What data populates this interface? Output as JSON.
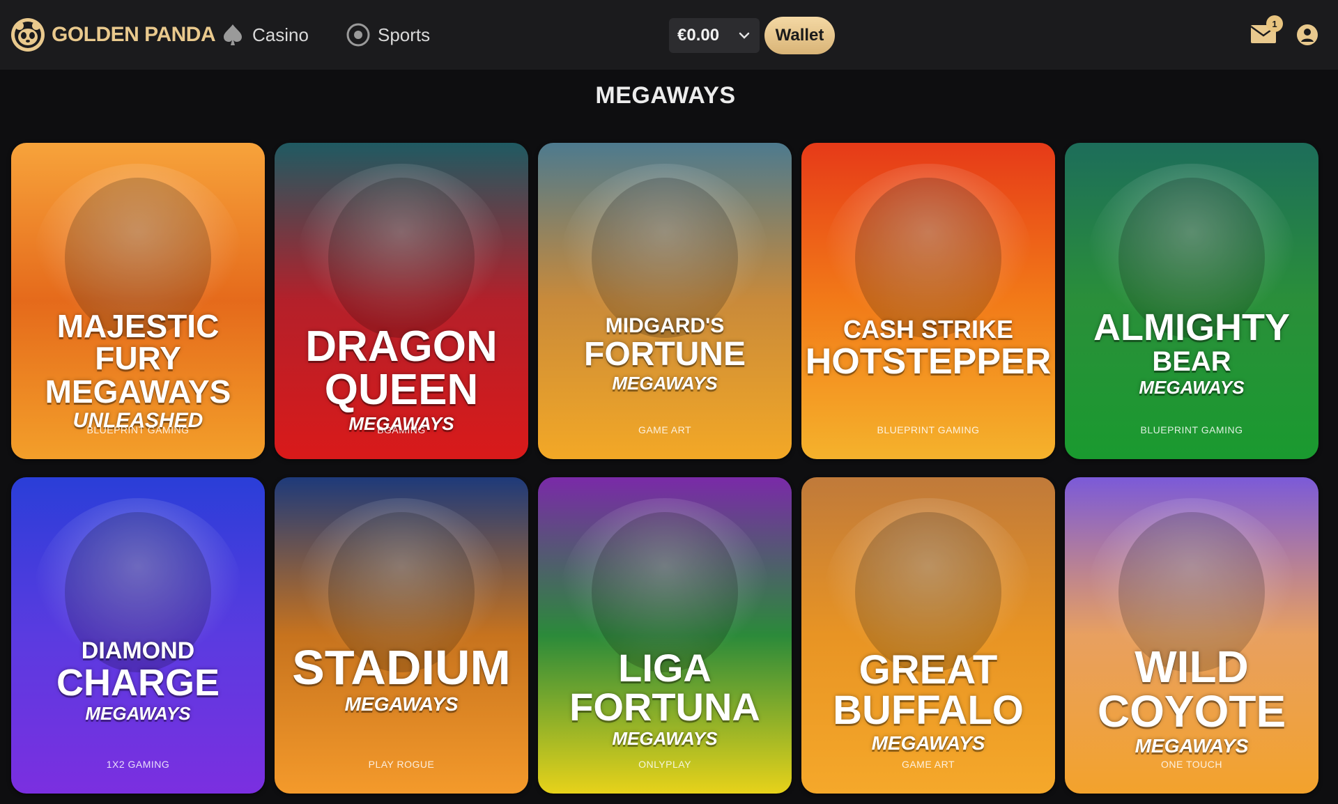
{
  "header": {
    "logo_text": "GOLDEN PANDA",
    "nav": [
      {
        "label": "Casino",
        "icon": "spade-icon"
      },
      {
        "label": "Sports",
        "icon": "soccer-ball-icon"
      }
    ],
    "balance": "€0.00",
    "wallet_label": "Wallet",
    "mail_badge": "1"
  },
  "section": {
    "title": "MEGAWAYS"
  },
  "games": [
    {
      "line1": "MAJESTIC FURY",
      "line2": "MEGAWAYS",
      "sub": "UNLEASHED",
      "sub2": "",
      "provider": "BLUEPRINT GAMING",
      "palette": [
        "#f7a33b",
        "#e56a1b",
        "#f39f2a"
      ]
    },
    {
      "line1": "DRAGON QUEEN",
      "line2": "",
      "sub": "MEGAWAYS",
      "sub2": "",
      "provider": "BGAMING",
      "palette": [
        "#1f5a62",
        "#b4202a",
        "#d91a1a"
      ]
    },
    {
      "line1": "MIDGARD'S",
      "line2": "FORTUNE",
      "sub": "MEGAWAYS",
      "sub2": "",
      "provider": "GAME ART",
      "palette": [
        "#4d7a8e",
        "#c98a3a",
        "#f3a826"
      ]
    },
    {
      "line1": "CASH STRIKE",
      "line2": "HOTSTEPPER",
      "sub": "",
      "sub2": "",
      "provider": "BLUEPRINT GAMING",
      "palette": [
        "#e63a18",
        "#f27a18",
        "#f5b22c"
      ]
    },
    {
      "line1": "ALMIGHTY",
      "line2": "BEAR",
      "sub": "MEGAWAYS",
      "sub2": "",
      "provider": "BLUEPRINT GAMING",
      "palette": [
        "#1d6d5a",
        "#2a8f3a",
        "#1a9a2f"
      ]
    },
    {
      "line1": "DIAMOND",
      "line2": "CHARGE",
      "sub": "MEGAWAYS",
      "sub2": "",
      "provider": "1X2 GAMING",
      "palette": [
        "#2a3ed8",
        "#5a3be0",
        "#7b2fe0"
      ]
    },
    {
      "line1": "STADIUM",
      "line2": "",
      "sub": "MEGAWAYS",
      "sub2": "",
      "provider": "PLAY ROGUE",
      "palette": [
        "#1e3a7a",
        "#c7731e",
        "#f49a2b"
      ]
    },
    {
      "line1": "LIGA FORTUNA",
      "line2": "",
      "sub": "MEGAWAYS",
      "sub2": "",
      "provider": "ONLYPLAY",
      "palette": [
        "#7a2aa8",
        "#2b8a3a",
        "#e7d21a"
      ]
    },
    {
      "line1": "GREAT BUFFALO",
      "line2": "",
      "sub": "MEGAWAYS",
      "sub2": "",
      "provider": "GAME ART",
      "palette": [
        "#c07a3a",
        "#e89424",
        "#f5a82a"
      ]
    },
    {
      "line1": "WILD COYOTE",
      "line2": "",
      "sub": "MEGAWAYS",
      "sub2": "",
      "provider": "ONE TOUCH",
      "palette": [
        "#7b5ad8",
        "#e8a060",
        "#f3a22c"
      ]
    }
  ],
  "colors": {
    "background": "#0e0e10",
    "header": "#1b1b1d",
    "accent_gold": "#e9c98d"
  }
}
